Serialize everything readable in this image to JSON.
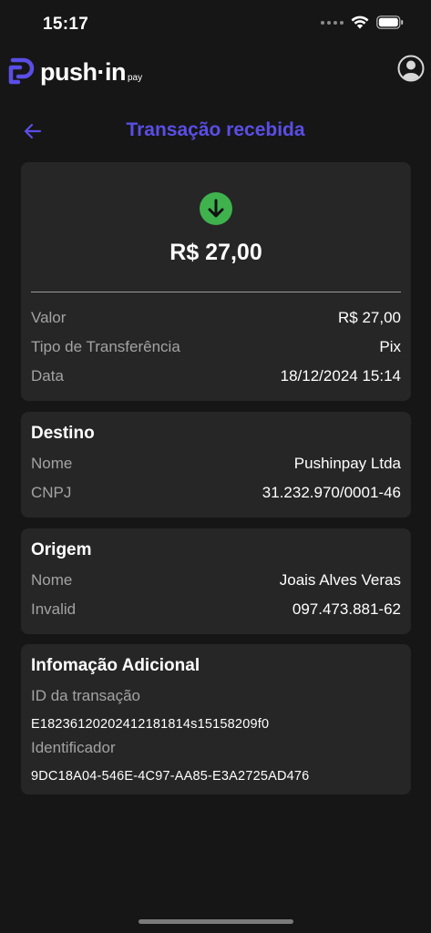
{
  "status_bar": {
    "time": "15:17"
  },
  "header": {
    "logo_text": "push·in",
    "logo_sub": "pay"
  },
  "title": "Transação recebida",
  "summary": {
    "amount": "R$ 27,00",
    "rows": [
      {
        "label": "Valor",
        "value": "R$ 27,00"
      },
      {
        "label": "Tipo de Transferência",
        "value": "Pix"
      },
      {
        "label": "Data",
        "value": "18/12/2024 15:14"
      }
    ]
  },
  "destino": {
    "heading": "Destino",
    "rows": [
      {
        "label": "Nome",
        "value": "Pushinpay Ltda"
      },
      {
        "label": "CNPJ",
        "value": "31.232.970/0001-46"
      }
    ]
  },
  "origem": {
    "heading": "Origem",
    "rows": [
      {
        "label": "Nome",
        "value": "Joais Alves Veras"
      },
      {
        "label": "Invalid",
        "value": "097.473.881-62"
      }
    ]
  },
  "info": {
    "heading": "Infomação Adicional",
    "transaction_id_label": "ID da transação",
    "transaction_id": "E18236120202412181814s15158209f0",
    "identifier_label": "Identificador",
    "identifier": "9DC18A04-546E-4C97-AA85-E3A2725AD476"
  },
  "colors": {
    "background": "#161616",
    "card": "#262626",
    "accent": "#5a4ee6",
    "success": "#3fb24d",
    "muted_text": "#a3a3a3"
  },
  "icons": [
    "wifi-icon",
    "battery-icon",
    "logo-mark-icon",
    "profile-icon",
    "back-arrow-icon",
    "arrow-down-icon"
  ]
}
